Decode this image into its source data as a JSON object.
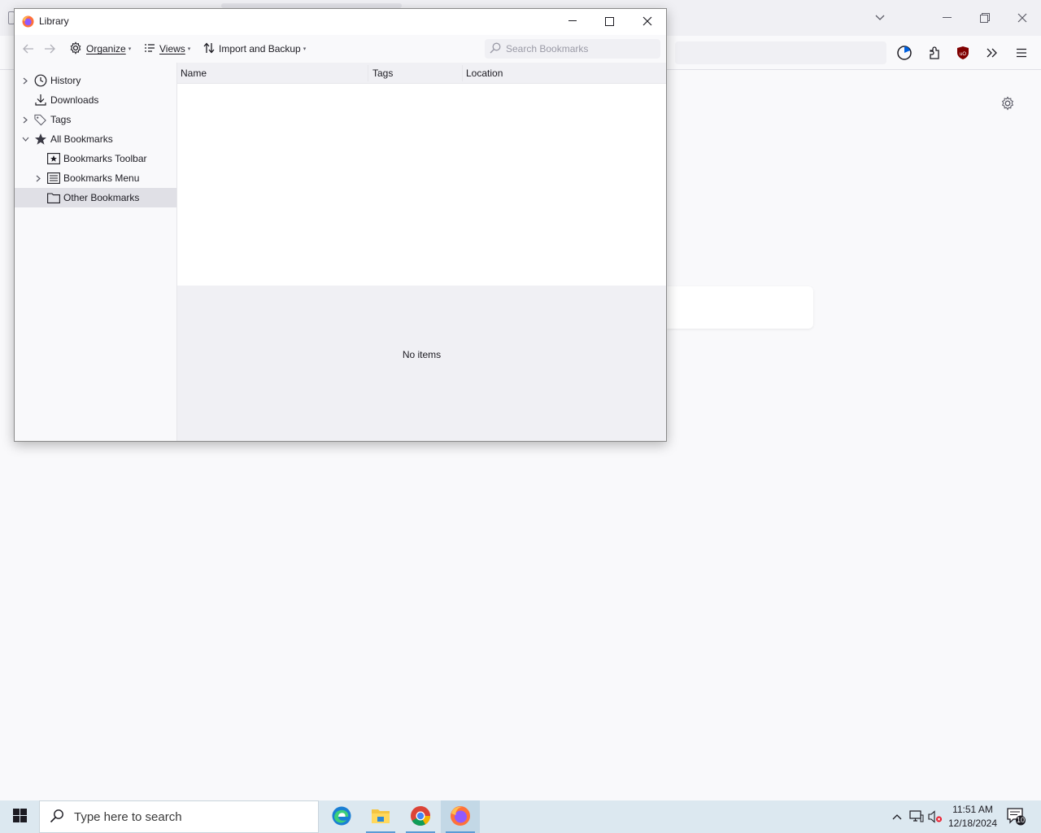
{
  "library": {
    "title": "Library",
    "toolbar": {
      "organize_label": "Organize",
      "views_label": "Views",
      "import_label": "Import and Backup",
      "search_placeholder": "Search Bookmarks"
    },
    "sidebar": {
      "items": [
        {
          "label": "History",
          "icon": "clock-icon"
        },
        {
          "label": "Downloads",
          "icon": "download-icon"
        },
        {
          "label": "Tags",
          "icon": "tag-icon"
        },
        {
          "label": "All Bookmarks",
          "icon": "star-icon"
        },
        {
          "label": "Bookmarks Toolbar",
          "icon": "bookmarks-toolbar-icon"
        },
        {
          "label": "Bookmarks Menu",
          "icon": "bookmarks-menu-icon"
        },
        {
          "label": "Other Bookmarks",
          "icon": "folder-icon",
          "selected": true
        }
      ]
    },
    "columns": [
      "Name",
      "Tags",
      "Location"
    ],
    "empty_message": "No items"
  },
  "taskbar": {
    "search_placeholder": "Type here to search",
    "clock_time": "11:51 AM",
    "clock_date": "12/18/2024",
    "notification_count": "10",
    "apps": [
      "edge-icon",
      "file-explorer-icon",
      "chrome-icon",
      "firefox-icon"
    ]
  },
  "colors": {
    "accent": "#5b9bd5",
    "selected_row": "#e0e0e6",
    "ublock_red": "#800000"
  }
}
